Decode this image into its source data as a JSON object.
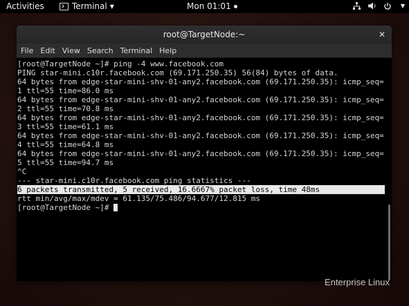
{
  "topbar": {
    "activities": "Activities",
    "app_name": "Terminal",
    "clock": "Mon 01:01"
  },
  "window": {
    "title": "root@TargetNode:~",
    "close_glyph": "✕",
    "menu": [
      "File",
      "Edit",
      "View",
      "Search",
      "Terminal",
      "Help"
    ]
  },
  "terminal": {
    "lines": [
      "[root@TargetNode ~]# ping -4 www.facebook.com",
      "PING star-mini.c10r.facebook.com (69.171.250.35) 56(84) bytes of data.",
      "64 bytes from edge-star-mini-shv-01-any2.facebook.com (69.171.250.35): icmp_seq=",
      "1 ttl=55 time=86.0 ms",
      "64 bytes from edge-star-mini-shv-01-any2.facebook.com (69.171.250.35): icmp_seq=",
      "2 ttl=55 time=70.8 ms",
      "64 bytes from edge-star-mini-shv-01-any2.facebook.com (69.171.250.35): icmp_seq=",
      "3 ttl=55 time=61.1 ms",
      "64 bytes from edge-star-mini-shv-01-any2.facebook.com (69.171.250.35): icmp_seq=",
      "4 ttl=55 time=64.8 ms",
      "64 bytes from edge-star-mini-shv-01-any2.facebook.com (69.171.250.35): icmp_seq=",
      "5 ttl=55 time=94.7 ms",
      "^C",
      "--- star-mini.c10r.facebook.com ping statistics ---",
      "6 packets transmitted, 5 received, 16.6667% packet loss, time 48ms",
      "rtt min/avg/max/mdev = 61.135/75.486/94.677/12.815 ms",
      "[root@TargetNode ~]# "
    ],
    "highlight_line_index": 14
  },
  "brand": "Enterprise Linux",
  "icon_names": [
    "terminal-icon",
    "network-icon",
    "volume-icon",
    "power-icon",
    "chevron-down-icon",
    "close-icon"
  ]
}
